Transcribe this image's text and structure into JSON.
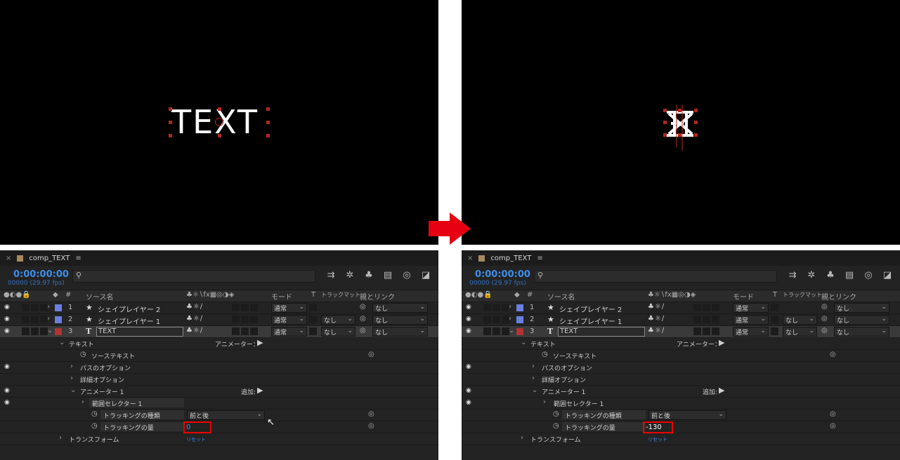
{
  "left": {
    "preview_text": "TEXT",
    "comp_tab": "comp_TEXT",
    "timecode": "0:00:00:00",
    "fps": "00000 (29.97 fps)",
    "headers": {
      "num": "#",
      "source": "ソース名",
      "mode": "モード",
      "t": "T",
      "trkmat": "トラックマット",
      "parent": "親とリンク"
    },
    "layers": [
      {
        "num": "1",
        "name": "シェイプレイヤー 2",
        "mode": "通常",
        "trkmat": "",
        "parent": "なし",
        "color": "#6b7fe0"
      },
      {
        "num": "2",
        "name": "シェイプレイヤー 1",
        "mode": "通常",
        "trkmat": "なし",
        "parent": "なし",
        "color": "#6b7fe0"
      },
      {
        "num": "3",
        "name": "TEXT",
        "mode": "通常",
        "trkmat": "なし",
        "parent": "なし",
        "color": "#b03434"
      }
    ],
    "props": {
      "text": "テキスト",
      "animator_label": "アニメーター：",
      "source_text": "ソーステキスト",
      "path_options": "パスのオプション",
      "more_options": "詳細オプション",
      "animator1": "アニメーター 1",
      "add_label": "追加:",
      "range_selector": "範囲セレクター 1",
      "tracking_type": "トラッキングの種類",
      "tracking_type_value": "前と後",
      "tracking_amount": "トラッキングの量",
      "tracking_amount_value": "0",
      "reset": "リセット",
      "transform": "トランスフォーム"
    }
  },
  "right": {
    "comp_tab": "comp_TEXT",
    "timecode": "0:00:00:00",
    "fps": "00000 (29.97 fps)",
    "headers": {
      "num": "#",
      "source": "ソース名",
      "mode": "モード",
      "t": "T",
      "trkmat": "トラックマット",
      "parent": "親とリンク"
    },
    "layers": [
      {
        "num": "1",
        "name": "シェイプレイヤー 2",
        "mode": "通常",
        "trkmat": "",
        "parent": "なし",
        "color": "#6b7fe0"
      },
      {
        "num": "2",
        "name": "シェイプレイヤー 1",
        "mode": "通常",
        "trkmat": "なし",
        "parent": "なし",
        "color": "#6b7fe0"
      },
      {
        "num": "3",
        "name": "TEXT",
        "mode": "通常",
        "trkmat": "なし",
        "parent": "なし",
        "color": "#b03434"
      }
    ],
    "props": {
      "text": "テキスト",
      "animator_label": "アニメーター：",
      "source_text": "ソーステキスト",
      "path_options": "パスのオプション",
      "more_options": "詳細オプション",
      "animator1": "アニメーター 1",
      "add_label": "追加:",
      "range_selector": "範囲セレクター 1",
      "tracking_type": "トラッキングの種類",
      "tracking_type_value": "前と後",
      "tracking_amount": "トラッキングの量",
      "tracking_amount_value": "-130",
      "reset": "リセット",
      "transform": "トランスフォーム"
    }
  },
  "colors": {
    "timecode": "#3d8eea",
    "highlight": "#e00000",
    "arrow": "#e60012"
  },
  "icons": [
    "eye-icon",
    "audio-icon",
    "solo-icon",
    "lock-icon",
    "label-icon",
    "search-icon",
    "stopwatch-icon",
    "pickwhip-icon",
    "star-icon",
    "text-layer-icon",
    "play-triangle-icon"
  ]
}
